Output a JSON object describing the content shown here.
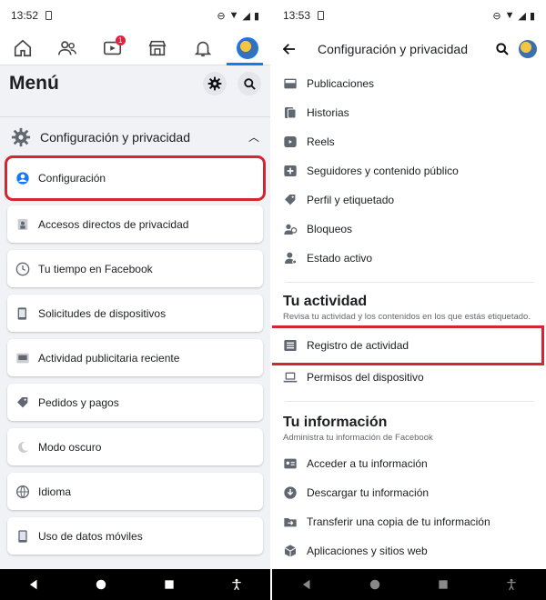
{
  "left": {
    "status": {
      "time": "13:52"
    },
    "menu_title": "Menú",
    "section": {
      "label": "Configuración y privacidad"
    },
    "tab_badge": "1",
    "items": [
      {
        "label": "Configuración",
        "icon": "account-circle-icon"
      },
      {
        "label": "Accesos directos de privacidad",
        "icon": "lock-icon"
      },
      {
        "label": "Tu tiempo en Facebook",
        "icon": "clock-icon"
      },
      {
        "label": "Solicitudes de dispositivos",
        "icon": "device-icon"
      },
      {
        "label": "Actividad publicitaria reciente",
        "icon": "ad-icon"
      },
      {
        "label": "Pedidos y pagos",
        "icon": "tag-icon"
      },
      {
        "label": "Modo oscuro",
        "icon": "moon-icon"
      },
      {
        "label": "Idioma",
        "icon": "globe-icon"
      },
      {
        "label": "Uso de datos móviles",
        "icon": "phone-icon"
      }
    ]
  },
  "right": {
    "status": {
      "time": "13:53"
    },
    "title": "Configuración y privacidad",
    "top_items": [
      {
        "label": "Publicaciones",
        "icon": "posts-icon"
      },
      {
        "label": "Historias",
        "icon": "stories-icon"
      },
      {
        "label": "Reels",
        "icon": "reels-icon"
      },
      {
        "label": "Seguidores y contenido público",
        "icon": "followers-icon"
      },
      {
        "label": "Perfil y etiquetado",
        "icon": "tag-icon"
      },
      {
        "label": "Bloqueos",
        "icon": "block-user-icon"
      },
      {
        "label": "Estado activo",
        "icon": "active-status-icon"
      }
    ],
    "activity": {
      "title": "Tu actividad",
      "subtitle": "Revisa tu actividad y los contenidos en los que estás etiquetado.",
      "items": [
        {
          "label": "Registro de actividad",
          "icon": "list-icon"
        },
        {
          "label": "Permisos del dispositivo",
          "icon": "laptop-icon"
        }
      ]
    },
    "info": {
      "title": "Tu información",
      "subtitle": "Administra tu información de Facebook",
      "items": [
        {
          "label": "Acceder a tu información",
          "icon": "id-card-icon"
        },
        {
          "label": "Descargar tu información",
          "icon": "download-icon"
        },
        {
          "label": "Transferir una copia de tu información",
          "icon": "folder-icon"
        },
        {
          "label": "Aplicaciones y sitios web",
          "icon": "cube-icon"
        }
      ]
    }
  },
  "colors": {
    "accent": "#1877f2",
    "highlight": "#d32630",
    "badge": "#e41e3f"
  }
}
